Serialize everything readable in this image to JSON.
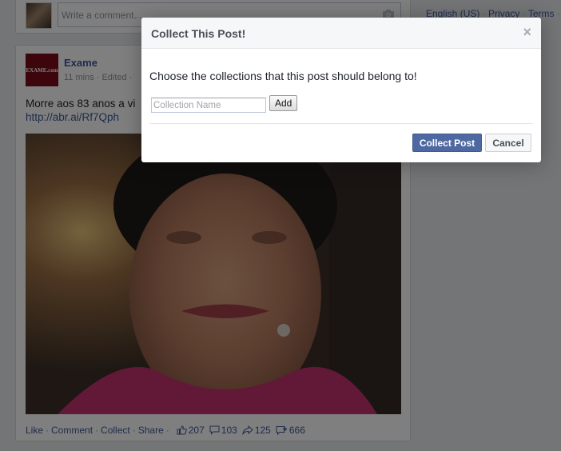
{
  "comment_box": {
    "placeholder": "Write a comment..."
  },
  "post": {
    "page_avatar_text": "EXAME.com",
    "page_name": "Exame",
    "meta": "11 mins · Edited ·",
    "text": "Morre aos 83 anos a vi",
    "link": "http://abr.ai/Rf7Qph",
    "actions": {
      "like": "Like",
      "comment": "Comment",
      "collect": "Collect",
      "share": "Share",
      "separator": "·"
    },
    "stats": {
      "likes": "207",
      "comments": "103",
      "shares": "125",
      "collects": "666"
    }
  },
  "footer": {
    "links": [
      "English (US)",
      "Privacy",
      "Terms"
    ],
    "separator": "·"
  },
  "dialog": {
    "title": "Collect This Post!",
    "close_glyph": "×",
    "prompt": "Choose the collections that this post should belong to!",
    "input_placeholder": "Collection Name",
    "add_label": "Add",
    "collect_label": "Collect Post",
    "cancel_label": "Cancel"
  },
  "icons": {
    "camera": "camera-icon",
    "like": "thumbs-up-icon",
    "comment": "speech-bubble-icon",
    "share": "share-arrow-icon",
    "collect": "collect-add-icon",
    "close": "close-icon"
  },
  "colors": {
    "link_blue": "#3b5998",
    "primary_button": "#4e69a2",
    "overlay": "rgba(0,0,0,0.5)"
  }
}
